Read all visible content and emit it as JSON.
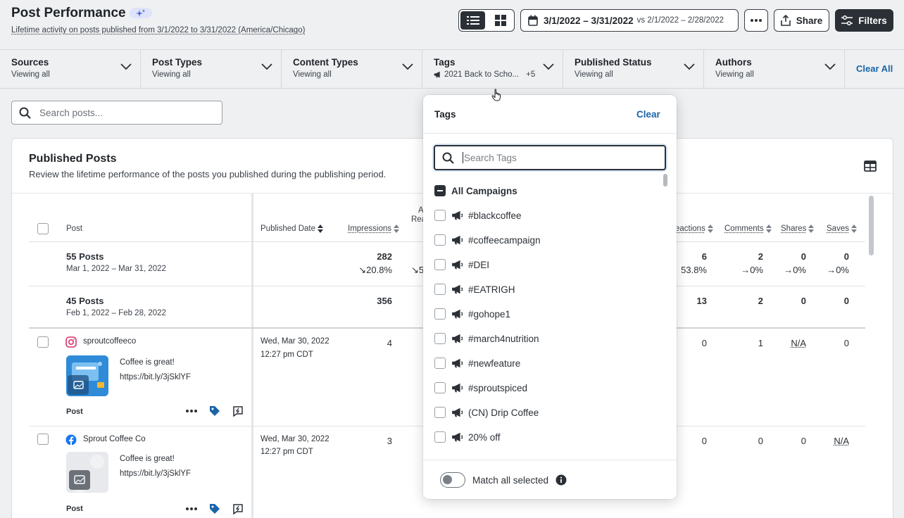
{
  "header": {
    "title": "Post Performance",
    "subtitle": "Lifetime activity on posts published from 3/1/2022 to 3/31/2022 (America/Chicago)",
    "date_range": "3/1/2022 – 3/31/2022",
    "compare_range": "vs 2/1/2022 – 2/28/2022",
    "share_label": "Share",
    "filters_label": "Filters"
  },
  "filters": [
    {
      "label": "Sources",
      "value": "Viewing all"
    },
    {
      "label": "Post Types",
      "value": "Viewing all"
    },
    {
      "label": "Content Types",
      "value": "Viewing all"
    },
    {
      "label": "Tags",
      "value": "2021 Back to Scho...",
      "extra": "+5"
    },
    {
      "label": "Published Status",
      "value": "Viewing all"
    },
    {
      "label": "Authors",
      "value": "Viewing all"
    }
  ],
  "clear_all_label": "Clear All",
  "search": {
    "placeholder": "Search posts..."
  },
  "card": {
    "title": "Published Posts",
    "subtitle": "Review the lifetime performance of the posts you published during the publishing period."
  },
  "columns": {
    "post": "Post",
    "published_date": "Published Date",
    "impressions": "Impressions",
    "avg_reach_partial_top": "A",
    "avg_reach_partial_bottom": "Rea",
    "reactions": "eactions",
    "comments": "Comments",
    "shares": "Shares",
    "saves": "Saves"
  },
  "summary_rows": [
    {
      "count": "55 Posts",
      "range": "Mar 1, 2022 – Mar 31, 2022",
      "impressions": "282",
      "impressions_change": "↘20.8%",
      "reach_partial": "↘5",
      "reactions": "6",
      "reactions_change": "53.8%",
      "comments": "2",
      "comments_change": "→0%",
      "shares": "0",
      "shares_change": "→0%",
      "saves": "0",
      "saves_change": "→0%"
    },
    {
      "count": "45 Posts",
      "range": "Feb 1, 2022 – Feb 28, 2022",
      "impressions": "356",
      "reactions": "13",
      "comments": "2",
      "shares": "0",
      "saves": "0"
    }
  ],
  "posts": [
    {
      "network": "instagram",
      "account": "sproutcoffeeco",
      "text_line1": "Coffee is great!",
      "text_line2": "https://bit.ly/3jSklYF",
      "type": "Post",
      "date": "Wed, Mar 30, 2022",
      "time": "12:27 pm CDT",
      "impressions": "4",
      "reactions": "0",
      "comments": "1",
      "shares": "N/A",
      "saves": "0"
    },
    {
      "network": "facebook",
      "account": "Sprout Coffee Co",
      "text_line1": "Coffee is great!",
      "text_line2": "https://bit.ly/3jSklYF",
      "type": "Post",
      "date": "Wed, Mar 30, 2022",
      "time": "12:27 pm CDT",
      "impressions": "3",
      "reactions": "0",
      "comments": "0",
      "shares": "0",
      "saves": "N/A"
    }
  ],
  "tags_dropdown": {
    "title": "Tags",
    "clear_label": "Clear",
    "search_placeholder": "Search Tags",
    "all_label": "All Campaigns",
    "items": [
      "#blackcoffee",
      "#coffeecampaign",
      "#DEI",
      "#EATRIGH",
      "#gohope1",
      "#march4nutrition",
      "#newfeature",
      "#sproutspiced",
      "(CN) Drip Coffee",
      "20% off"
    ],
    "match_all_label": "Match all selected"
  },
  "colors": {
    "accent_link": "#1b64a8",
    "dark_button": "#2b3036",
    "tag_blue": "#1b64a8",
    "instagram": "#d6336c",
    "facebook": "#1877f2"
  }
}
